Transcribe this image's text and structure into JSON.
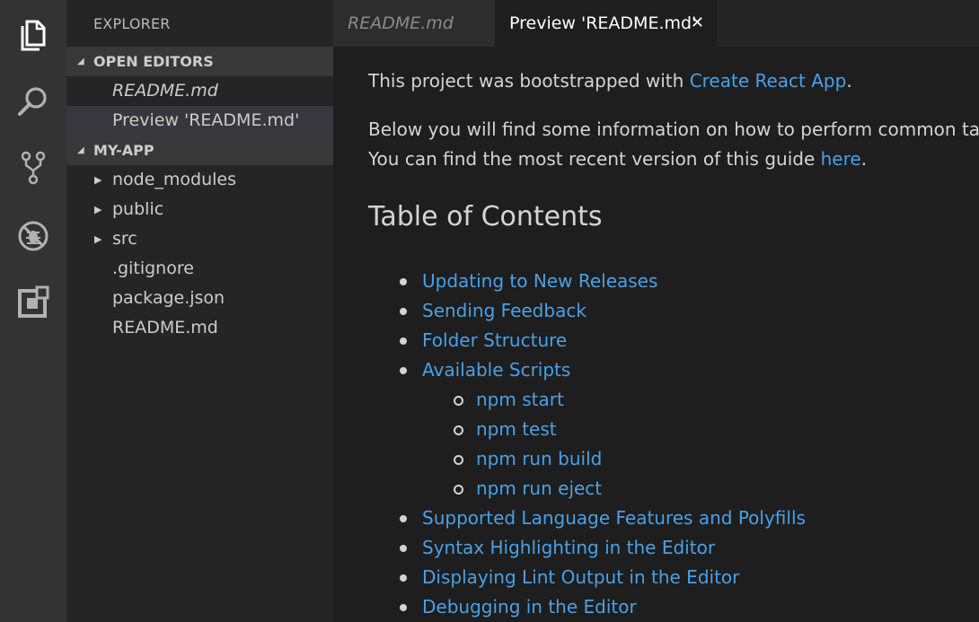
{
  "sidebar": {
    "title": "EXPLORER",
    "open_editors": {
      "label": "OPEN EDITORS",
      "items": [
        "README.md",
        "Preview 'README.md'"
      ]
    },
    "project": {
      "label": "MY-APP",
      "folders": [
        "node_modules",
        "public",
        "src"
      ],
      "files": [
        ".gitignore",
        "package.json",
        "README.md"
      ]
    }
  },
  "tabs": {
    "inactive_label": "README.md",
    "active_label": "Preview 'README.md'",
    "close_glyph": "✕"
  },
  "preview": {
    "intro_before": "This project was bootstrapped with ",
    "intro_link": "Create React App",
    "intro_after": ".",
    "para2_line1": "Below you will find some information on how to perform common tasks.",
    "para2_before": "You can find the most recent version of this guide ",
    "para2_link": "here",
    "para2_after": ".",
    "heading": "Table of Contents",
    "toc": [
      {
        "label": "Updating to New Releases",
        "level": 1
      },
      {
        "label": "Sending Feedback",
        "level": 1
      },
      {
        "label": "Folder Structure",
        "level": 1
      },
      {
        "label": "Available Scripts",
        "level": 1
      },
      {
        "label": "npm start",
        "level": 2
      },
      {
        "label": "npm test",
        "level": 2
      },
      {
        "label": "npm run build",
        "level": 2
      },
      {
        "label": "npm run eject",
        "level": 2
      },
      {
        "label": "Supported Language Features and Polyfills",
        "level": 1
      },
      {
        "label": "Syntax Highlighting in the Editor",
        "level": 1
      },
      {
        "label": "Displaying Lint Output in the Editor",
        "level": 1
      },
      {
        "label": "Debugging in the Editor",
        "level": 1
      }
    ]
  },
  "activity_bar": {
    "icons": [
      "files-icon",
      "search-icon",
      "source-control-icon",
      "debug-icon",
      "extensions-icon"
    ]
  },
  "colors": {
    "link": "#3794ff",
    "activity_bar": "#333333",
    "sidebar": "#252526",
    "editor": "#1e1e1e"
  }
}
